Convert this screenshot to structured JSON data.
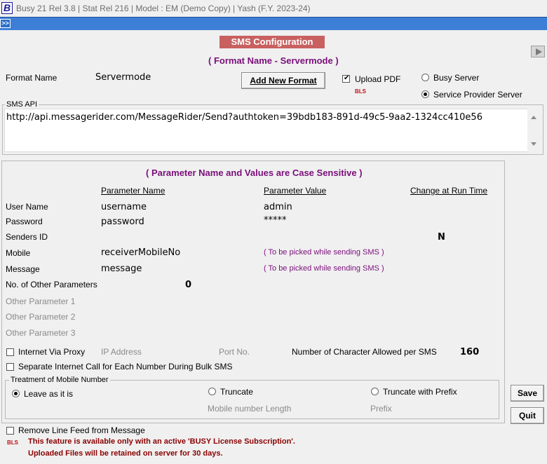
{
  "titlebar": {
    "logo": "B",
    "text": "Busy 21  Rel 3.8  |  Stat Rel 216  |  Model : EM (Demo Copy)  |  Yash (F.Y. 2023-24)"
  },
  "toolbar": {
    "expand_label": ">>"
  },
  "header": {
    "title": "SMS Configuration",
    "format_caption": "( Format Name - Servermode )"
  },
  "format": {
    "label": "Format Name",
    "value": "Servermode",
    "add_button": "Add New Format"
  },
  "upload_pdf": {
    "label": "Upload PDF",
    "checked": true,
    "badge": "BLS"
  },
  "server_options": [
    {
      "label": "Busy Server",
      "selected": false
    },
    {
      "label": "Service Provider Server",
      "selected": true
    }
  ],
  "sms_api": {
    "group_label": "SMS API",
    "url": "http://api.messagerider.com/MessageRider/Send?authtoken=39bdb183-891d-49c5-9aa2-1324cc410e56"
  },
  "params": {
    "caption": "( Parameter Name and Values are Case Sensitive )",
    "col_name": "Parameter Name",
    "col_value": "Parameter Value",
    "col_runtime": "Change at Run Time",
    "rows": [
      {
        "label": "User Name",
        "name": "username",
        "value": "admin"
      },
      {
        "label": "Password",
        "name": "password",
        "value": "*****"
      },
      {
        "label": "Senders ID",
        "name": "",
        "value": "",
        "runtime": "N"
      },
      {
        "label": "Mobile",
        "name": "receiverMobileNo",
        "note": "( To be picked while sending SMS )"
      },
      {
        "label": "Message",
        "name": "message",
        "note": "( To be picked while sending SMS )"
      }
    ],
    "other_count_label": "No. of Other Parameters",
    "other_count_value": "0",
    "other_labels": [
      "Other Parameter 1",
      "Other Parameter 2",
      "Other Parameter 3"
    ]
  },
  "internet": {
    "proxy_label": "Internet Via Proxy",
    "ip_label": "IP Address",
    "port_label": "Port No.",
    "chars_label": "Number of Character Allowed per SMS",
    "chars_value": "160",
    "separate_call_label": "Separate Internet Call for Each Number During Bulk SMS"
  },
  "mobile_treatment": {
    "group_label": "Treatment of Mobile Number",
    "options": [
      {
        "label": "Leave as it is",
        "selected": true
      },
      {
        "label": "Truncate",
        "selected": false
      },
      {
        "label": "Truncate with Prefix",
        "selected": false
      }
    ],
    "length_label": "Mobile number Length",
    "prefix_label": "Prefix"
  },
  "actions": {
    "save": "Save",
    "quit": "Quit"
  },
  "footer": {
    "remove_linefeed_label": "Remove Line Feed from Message",
    "badge": "BLS",
    "notice_1": "This feature is available only with an active 'BUSY License Subscription'.",
    "notice_2": "Uploaded Files will be retained on server for 30 days."
  }
}
